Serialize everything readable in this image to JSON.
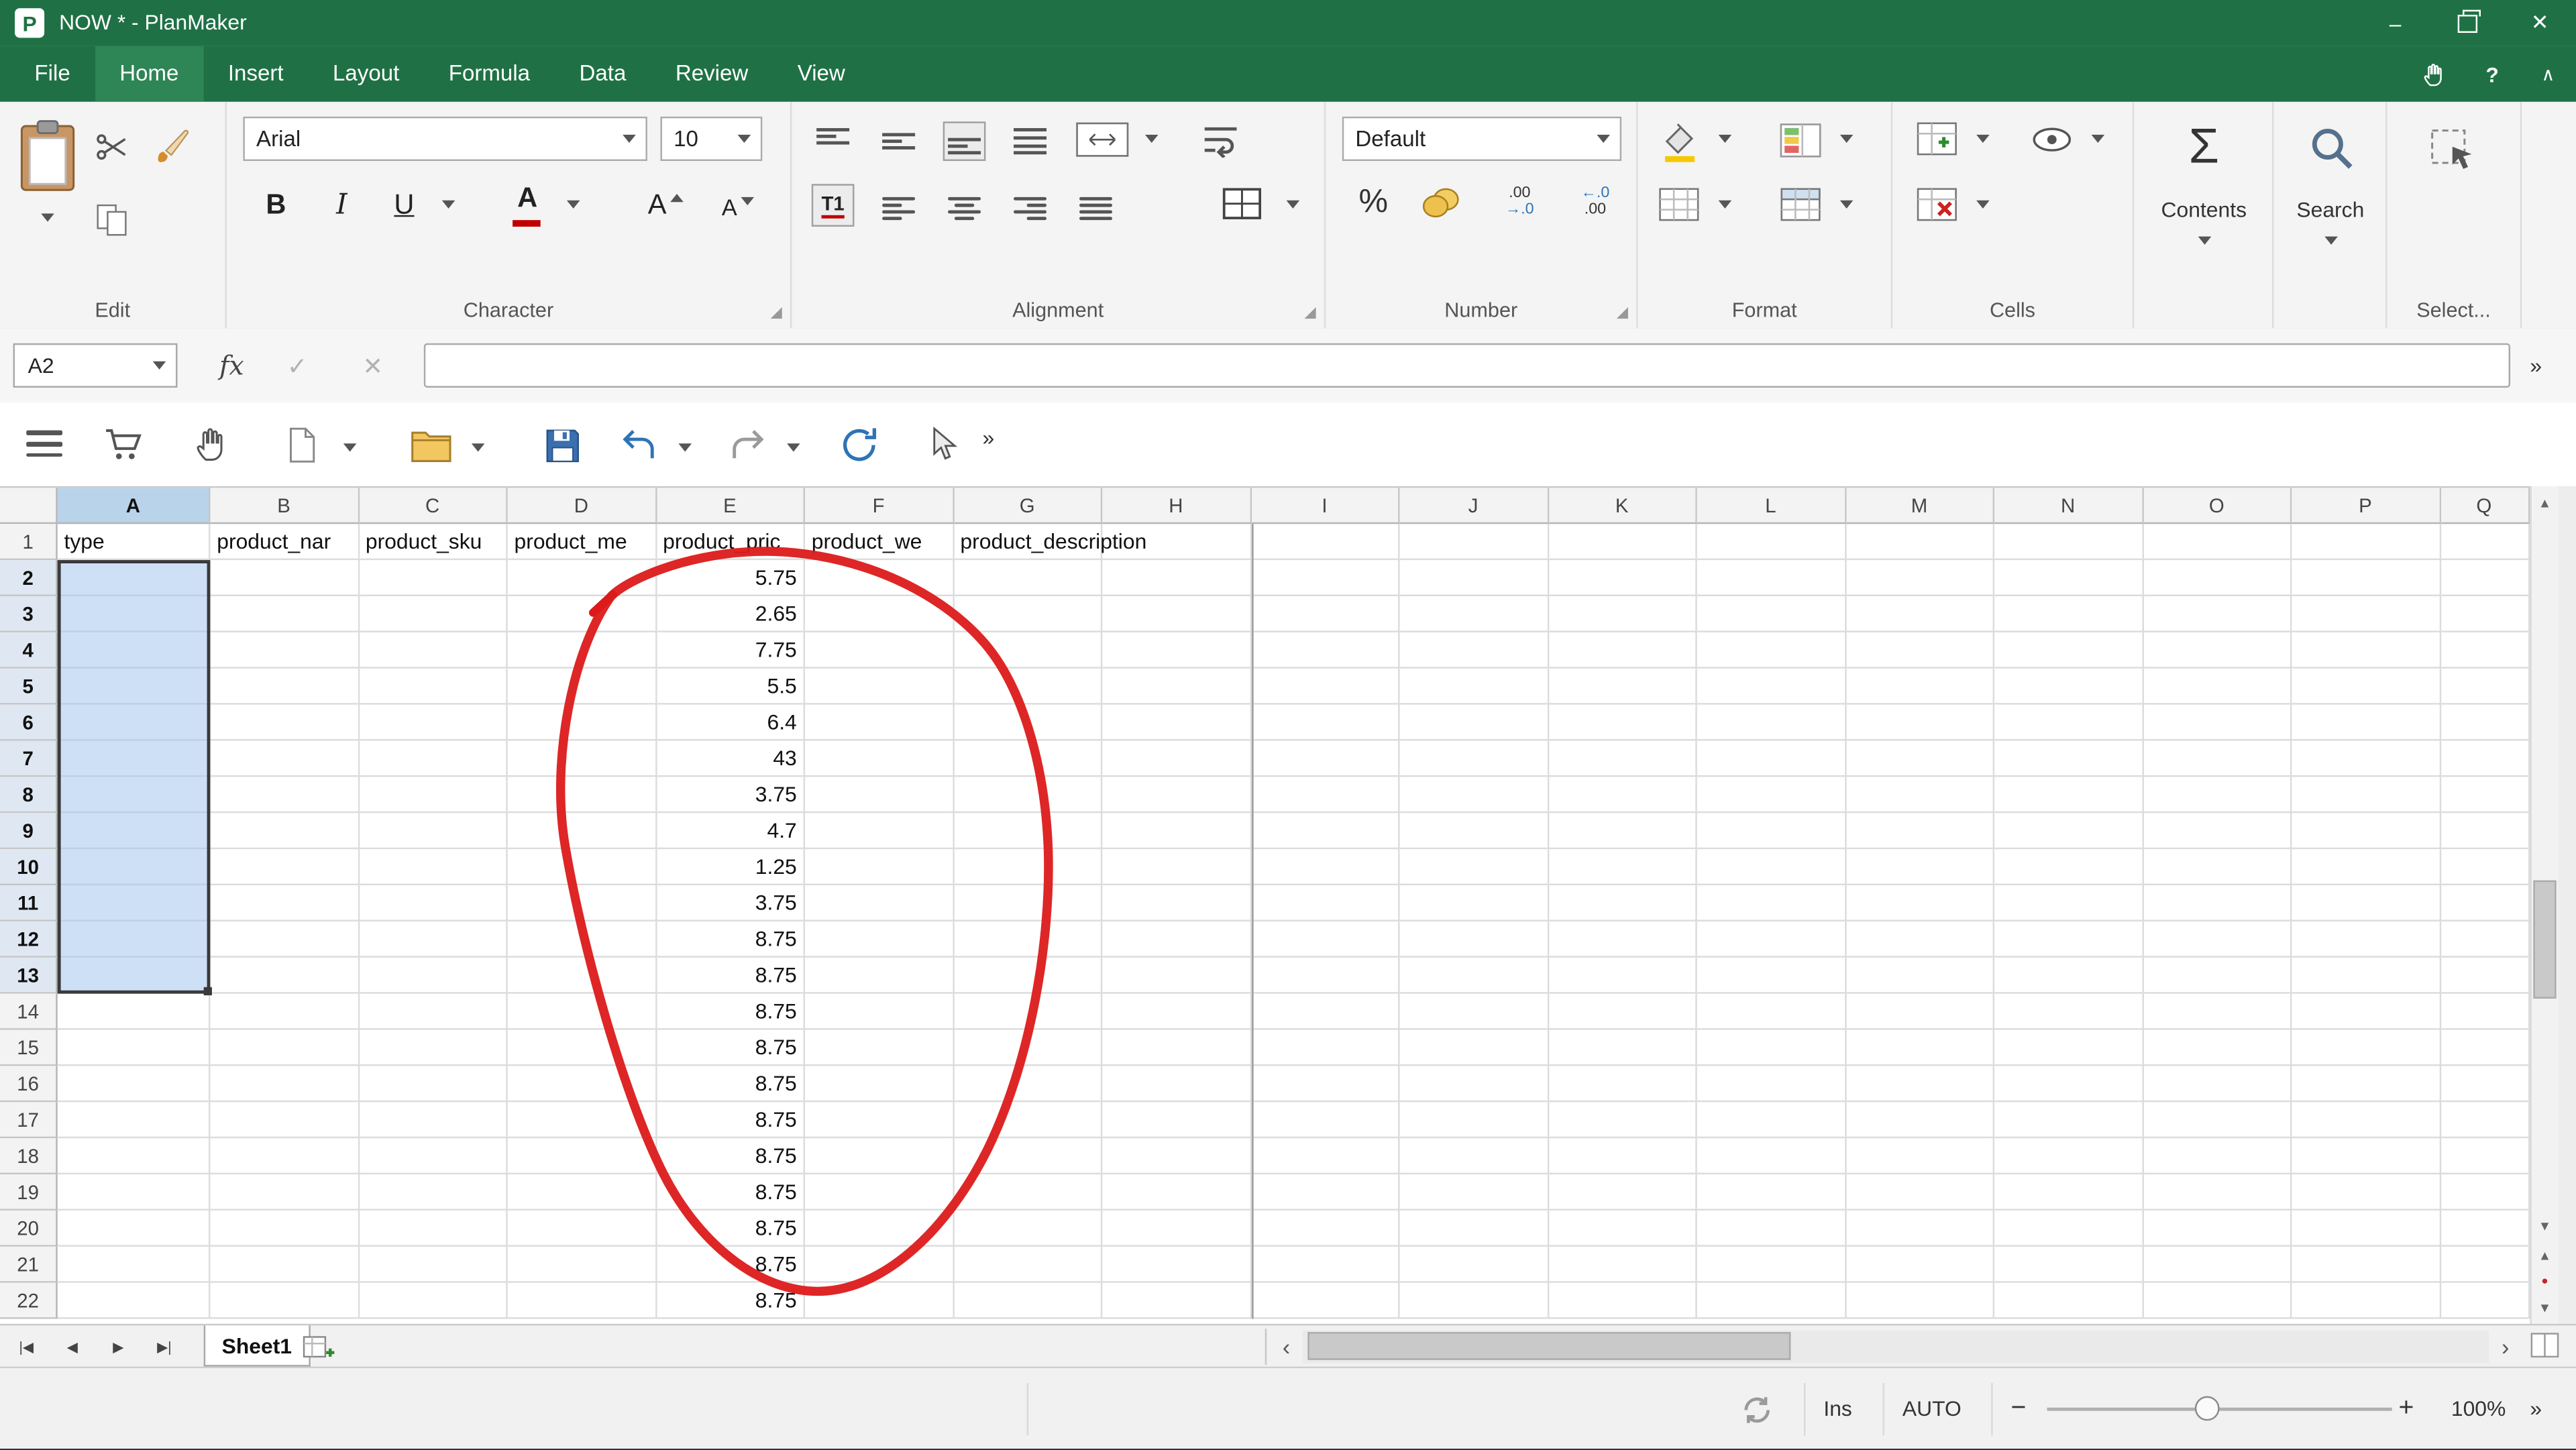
{
  "window": {
    "title": "NOW * - PlanMaker"
  },
  "menu": {
    "tabs": [
      {
        "label": "File"
      },
      {
        "label": "Home",
        "active": true
      },
      {
        "label": "Insert"
      },
      {
        "label": "Layout"
      },
      {
        "label": "Formula"
      },
      {
        "label": "Data"
      },
      {
        "label": "Review"
      },
      {
        "label": "View"
      }
    ]
  },
  "ribbon": {
    "edit": {
      "label": "Edit"
    },
    "character": {
      "label": "Character",
      "font_name": "Arial",
      "font_size": "10",
      "bold": "B",
      "italic": "I",
      "underline": "U",
      "font_color": "A",
      "grow": "A",
      "shrink": "A"
    },
    "alignment": {
      "label": "Alignment",
      "orientation": "T1"
    },
    "number": {
      "label": "Number",
      "format": "Default",
      "percent": "%",
      "dec_decrease_top": ".00",
      "dec_decrease_bottom": "→.0",
      "dec_increase_top": "←.0",
      "dec_increase_bottom": ".00"
    },
    "format": {
      "label": "Format"
    },
    "cells": {
      "label": "Cells"
    },
    "contents": {
      "label": "Contents",
      "sigma": "Σ"
    },
    "search": {
      "label": "Search"
    },
    "select": {
      "label": "Select..."
    }
  },
  "formula_bar": {
    "cell_reference": "A2",
    "fx_label": "fx",
    "value": ""
  },
  "grid": {
    "columns": [
      "A",
      "B",
      "C",
      "D",
      "E",
      "F",
      "G",
      "H",
      "I",
      "J",
      "K",
      "L",
      "M",
      "N",
      "O",
      "P",
      "Q"
    ],
    "row_count": 22,
    "header_row": {
      "A": "type",
      "B": "product_nar",
      "C": "product_sku",
      "D": "product_me",
      "E": "product_pric",
      "F": "product_we",
      "G": "product_description"
    },
    "e_values_rows_2_to_22": [
      "5.75",
      "2.65",
      "7.75",
      "5.5",
      "6.4",
      "43",
      "3.75",
      "4.7",
      "1.25",
      "3.75",
      "8.75",
      "8.75",
      "8.75",
      "8.75",
      "8.75",
      "8.75",
      "8.75",
      "8.75",
      "8.75",
      "8.75",
      "8.75"
    ],
    "selection": {
      "range": "A2:A13",
      "column": "A",
      "first_row": 2,
      "last_row": 13
    }
  },
  "sheet_bar": {
    "tabs": [
      {
        "label": "Sheet1",
        "active": true
      }
    ]
  },
  "status_bar": {
    "insert_mode": "Ins",
    "auto": "AUTO",
    "zoom_percent": "100%"
  },
  "annotation": {
    "type": "hand-drawn-ellipse",
    "color": "#dc1a1a",
    "around": "column E values rows 2-21"
  },
  "icons": {
    "logo_letter": "P",
    "minimize": "–",
    "close": "✕",
    "help": "?",
    "collapse": "∧",
    "check": "✓",
    "cancel": "✕",
    "overflow": "»",
    "nav_first": "|◀",
    "nav_prev": "◀",
    "nav_next": "▶",
    "nav_last": "▶|",
    "scroll_left": "‹",
    "scroll_right": "›",
    "scroll_up": "▲",
    "scroll_down": "▼",
    "mini_up": "▲",
    "mini_down": "▼",
    "record_dot": "●",
    "zoom_out": "−",
    "zoom_in": "+"
  }
}
